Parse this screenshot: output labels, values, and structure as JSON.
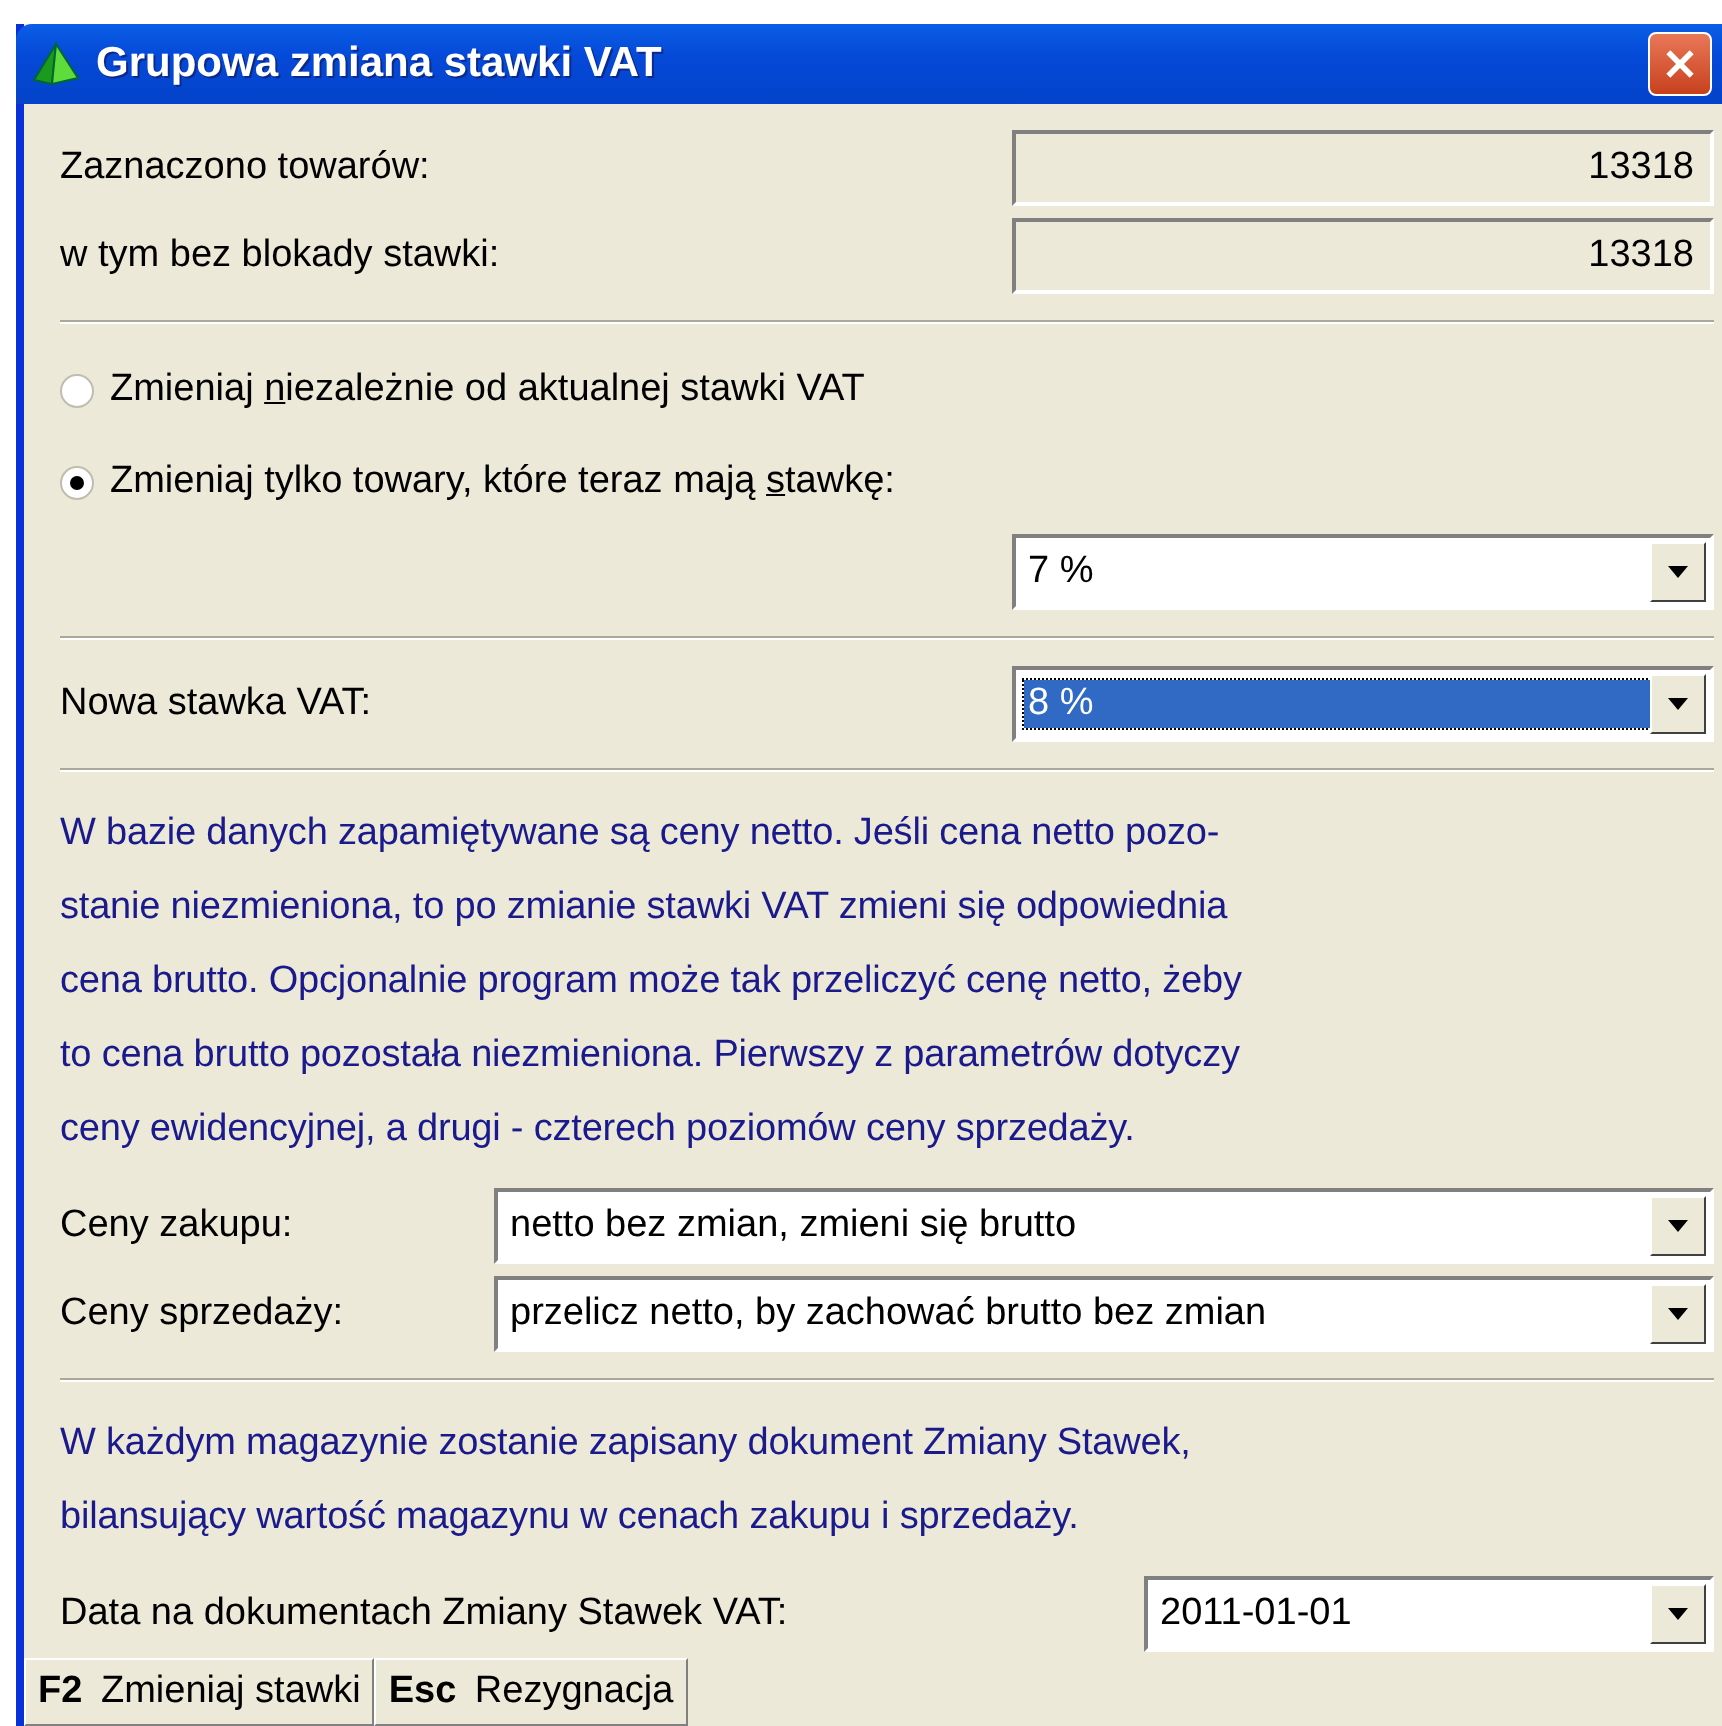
{
  "window": {
    "title": "Grupowa zmiana stawki VAT"
  },
  "counts": [
    {
      "label": "Zaznaczono towarów:",
      "value": "13318"
    },
    {
      "label": "w tym bez blokady stawki:",
      "value": "13318"
    }
  ],
  "mode_options": [
    {
      "label_before": "Zmieniaj ",
      "access_key": "n",
      "label_after": "iezależnie od aktualnej stawki VAT",
      "selected": false
    },
    {
      "label_before": "Zmieniaj tylko towary, które teraz mają ",
      "access_key": "s",
      "label_after": "tawkę:",
      "selected": true
    }
  ],
  "current_rate": {
    "value": "7 %",
    "focused": false
  },
  "new_rate": {
    "label": "Nowa stawka VAT:",
    "value": "8 %",
    "focused": true
  },
  "price_info": [
    "W bazie danych zapamiętywane są ceny netto. Jeśli cena netto pozo-",
    "stanie niezmieniona, to po zmianie stawki VAT zmieni się odpowiednia",
    "cena brutto. Opcjonalnie program może tak przeliczyć cenę netto, żeby",
    "to cena brutto pozostała niezmieniona. Pierwszy z parametrów dotyczy",
    "ceny ewidencyjnej, a drugi - czterech poziomów ceny sprzedaży."
  ],
  "price_options": [
    {
      "label": "Ceny zakupu:",
      "value": "netto bez zmian, zmieni się brutto"
    },
    {
      "label": "Ceny sprzedaży:",
      "value": "przelicz netto, by zachować brutto bez zmian"
    }
  ],
  "document_info": [
    "W każdym magazynie zostanie zapisany dokument Zmiany Stawek,",
    "bilansujący wartość magazynu w cenach zakupu i sprzedaży."
  ],
  "document_date": {
    "label": "Data na dokumentach Zmiany Stawek VAT:",
    "value": "2011-01-01"
  },
  "buttons": [
    {
      "key": "F2",
      "label": "Zmieniaj stawki"
    },
    {
      "key": "Esc",
      "label": "Rezygnacja"
    }
  ]
}
